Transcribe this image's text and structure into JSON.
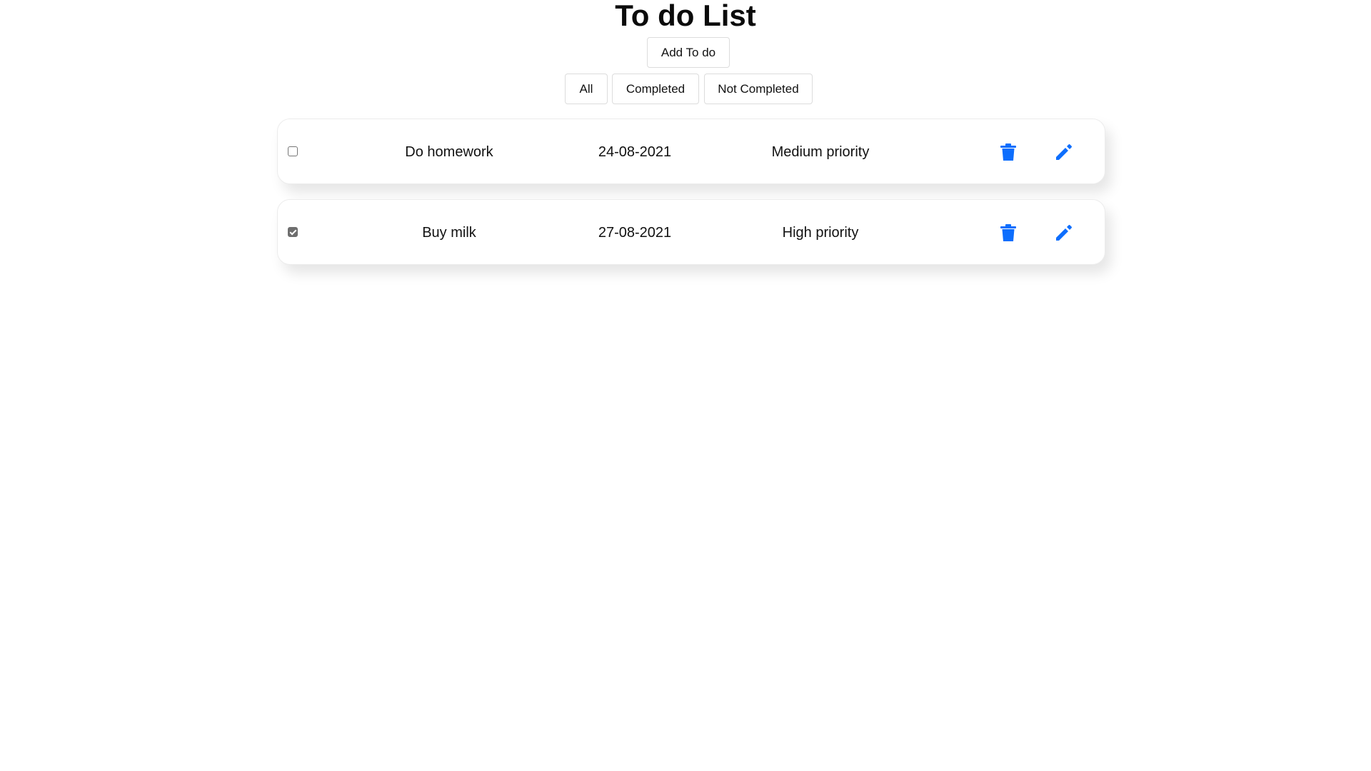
{
  "header": {
    "title": "To do List",
    "add_label": "Add To do"
  },
  "filters": {
    "all": "All",
    "completed": "Completed",
    "not_completed": "Not Completed"
  },
  "todos": [
    {
      "name": "Do homework",
      "date": "24-08-2021",
      "priority": "Medium priority",
      "completed": false
    },
    {
      "name": "Buy milk",
      "date": "27-08-2021",
      "priority": "High priority",
      "completed": true
    }
  ],
  "icons": {
    "delete": "trash-icon",
    "edit": "pencil-icon"
  },
  "colors": {
    "accent": "#0d6efd"
  }
}
